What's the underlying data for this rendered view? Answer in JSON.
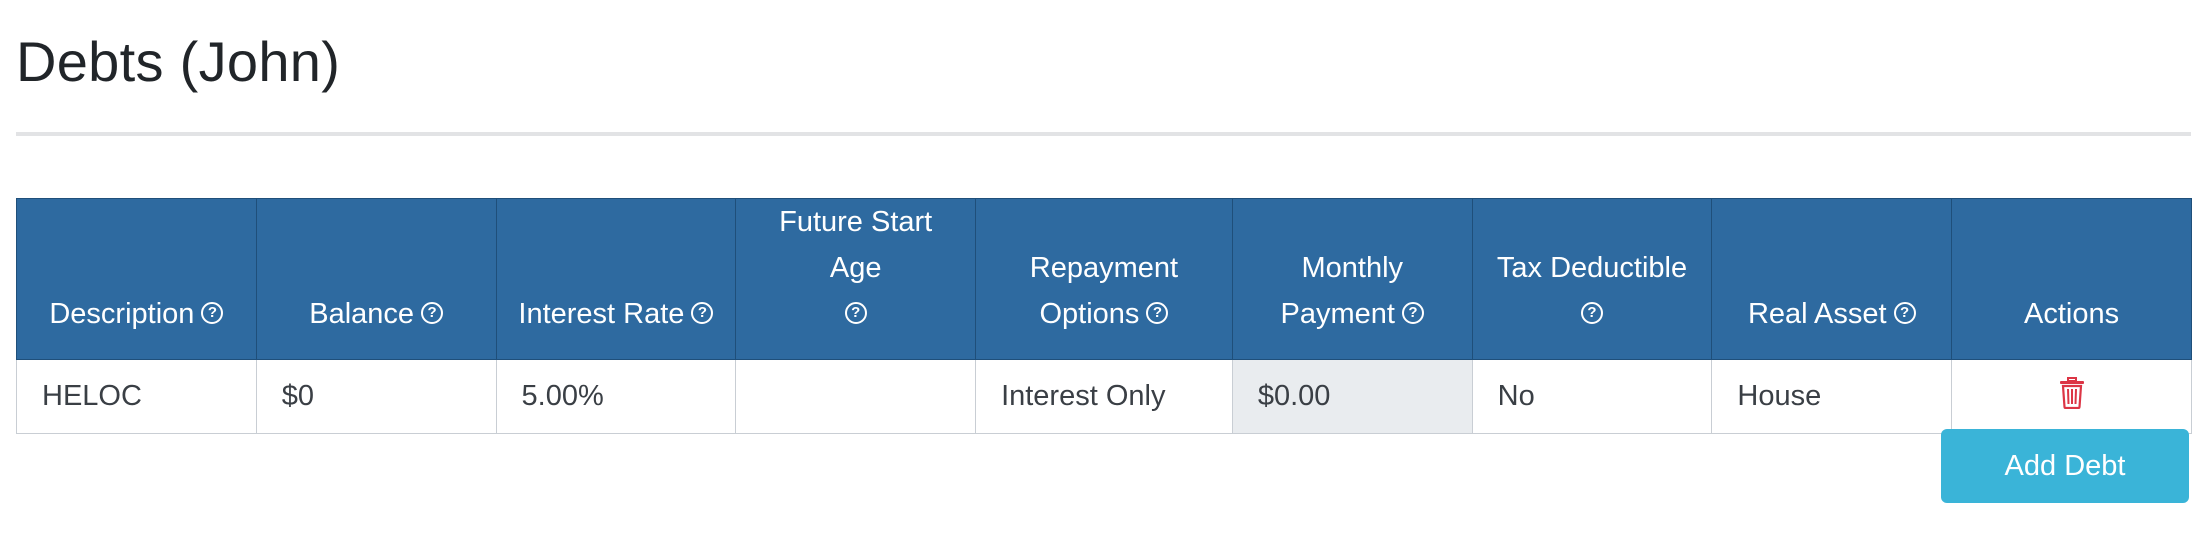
{
  "page": {
    "title": "Debts (John)"
  },
  "table": {
    "headers": {
      "description": "Description",
      "balance": "Balance",
      "interest_rate": "Interest Rate",
      "future_start_age": "Future Start Age",
      "repayment_options_line1": "Repayment",
      "repayment_options_line2": "Options",
      "monthly_payment_line1": "Monthly",
      "monthly_payment_line2": "Payment",
      "tax_deductible": "Tax Deductible",
      "real_asset": "Real Asset",
      "actions": "Actions"
    },
    "help_icon_glyph": "?",
    "rows": [
      {
        "description": "HELOC",
        "balance": "$0",
        "interest_rate": "5.00%",
        "future_start_age": "",
        "repayment_options": "Interest Only",
        "monthly_payment": "$0.00",
        "tax_deductible": "No",
        "real_asset": "House",
        "action_icon": "trash-icon"
      }
    ]
  },
  "buttons": {
    "add_debt": "Add Debt"
  },
  "colors": {
    "header_bg": "#2e6aa0",
    "readonly_bg": "#e9ecef",
    "delete_red": "#dc3545",
    "add_button_bg": "#3ab4d8"
  }
}
